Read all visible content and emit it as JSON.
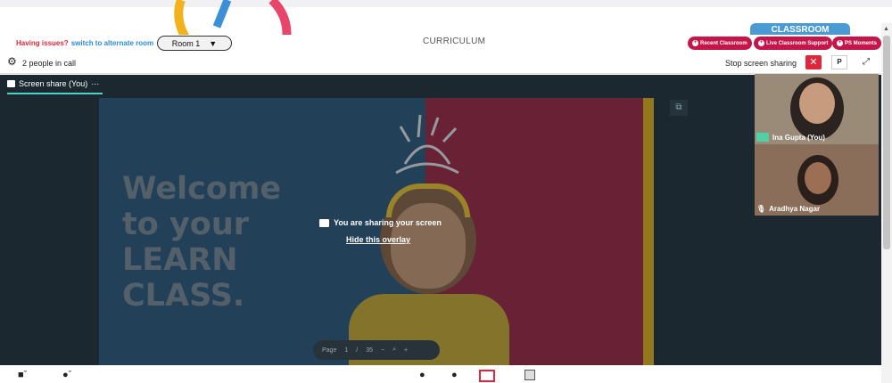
{
  "header": {
    "issue_prefix": "Having issues?",
    "issue_link": "switch to alternate room",
    "room_select": "Room 1",
    "curriculum_tab": "CURRICULUM",
    "classroom_tab": "CLASSROOM",
    "pills": [
      {
        "label": "Recent Classroom"
      },
      {
        "label": "Live Classroom Support"
      },
      {
        "label": "PS Moments"
      }
    ]
  },
  "call_bar": {
    "people_count": "2 people in call",
    "stop_sharing": "Stop screen sharing",
    "p_button": "P"
  },
  "share_tab": {
    "label": "Screen share (You)",
    "more": "···"
  },
  "slide": {
    "welcome_lines": [
      "Welcome",
      "to your",
      "LEARN",
      "CLASS."
    ]
  },
  "overlay": {
    "message": "You are sharing your screen",
    "hide_link": "Hide this overlay"
  },
  "pager": {
    "page_label": "Page",
    "current": "1",
    "separator": "/",
    "total": "35",
    "minus": "−",
    "plus": "+"
  },
  "participants": [
    {
      "name": "Ina Gupta (You)"
    },
    {
      "name": "Aradhya Nagar"
    }
  ],
  "colors": {
    "accent_red": "#c4164b",
    "classroom_blue": "#4a9ad3",
    "stage_bg": "#1c2830",
    "active_tab_teal": "#4fd1c5"
  }
}
